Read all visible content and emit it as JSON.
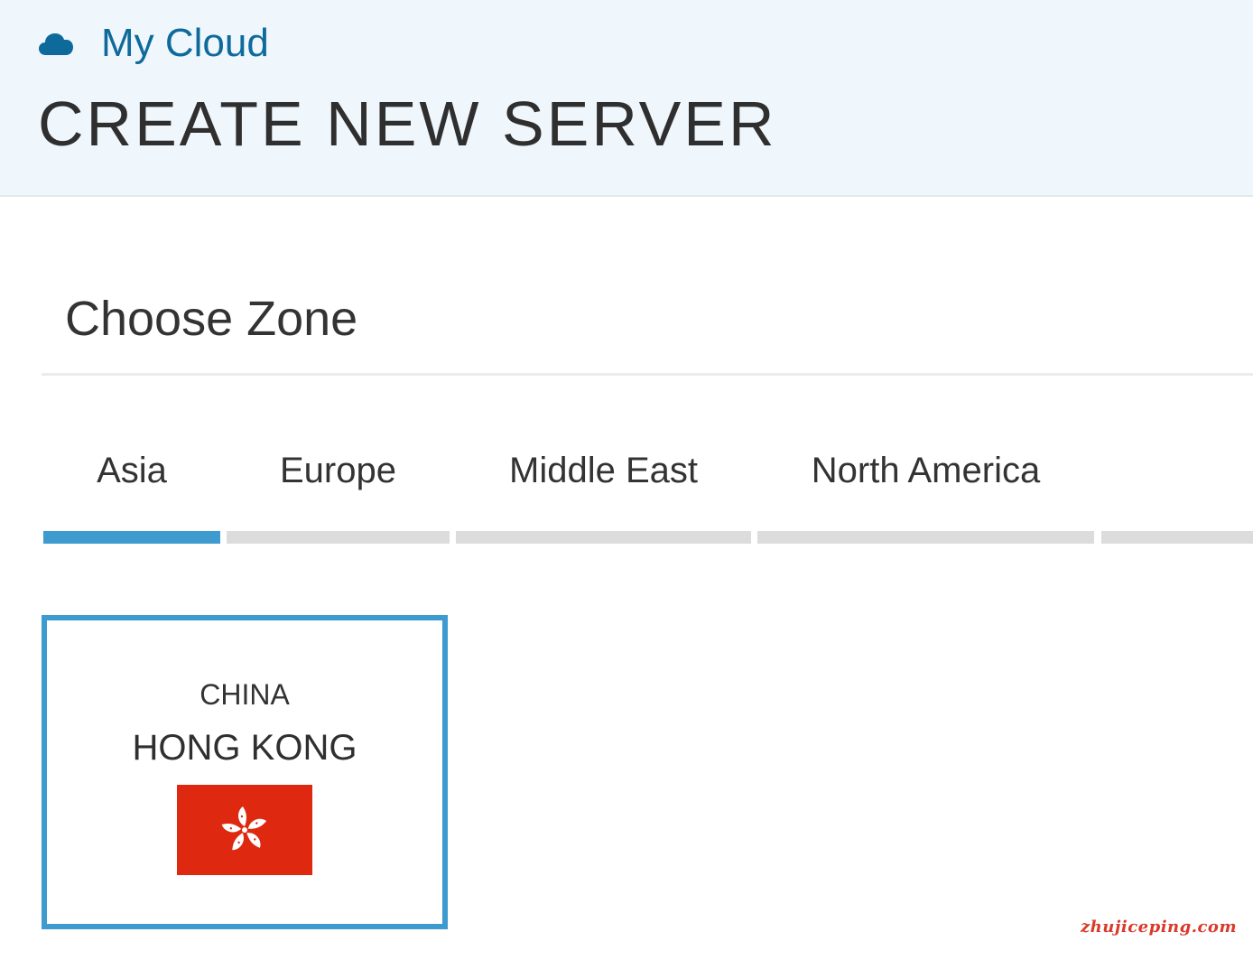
{
  "header": {
    "brand_icon": "cloud-icon",
    "brand_label": "My Cloud",
    "page_title": "CREATE NEW SERVER"
  },
  "section": {
    "title": "Choose Zone"
  },
  "tabs": [
    {
      "label": "Asia",
      "active": true
    },
    {
      "label": "Europe",
      "active": false
    },
    {
      "label": "Middle East",
      "active": false
    },
    {
      "label": "North America",
      "active": false
    },
    {
      "label": "",
      "active": false
    }
  ],
  "zones": [
    {
      "country": "CHINA",
      "city": "HONG KONG",
      "flag_icon": "hong-kong-flag-icon",
      "selected": true
    }
  ],
  "watermark": "zhujiceping.com",
  "colors": {
    "header_bg": "#eff7fd",
    "brand": "#0f6a9c",
    "accent": "#3d9bd0",
    "inactive_tab": "#dcdcdc",
    "flag_red": "#de2910",
    "watermark": "#d93a2b"
  }
}
